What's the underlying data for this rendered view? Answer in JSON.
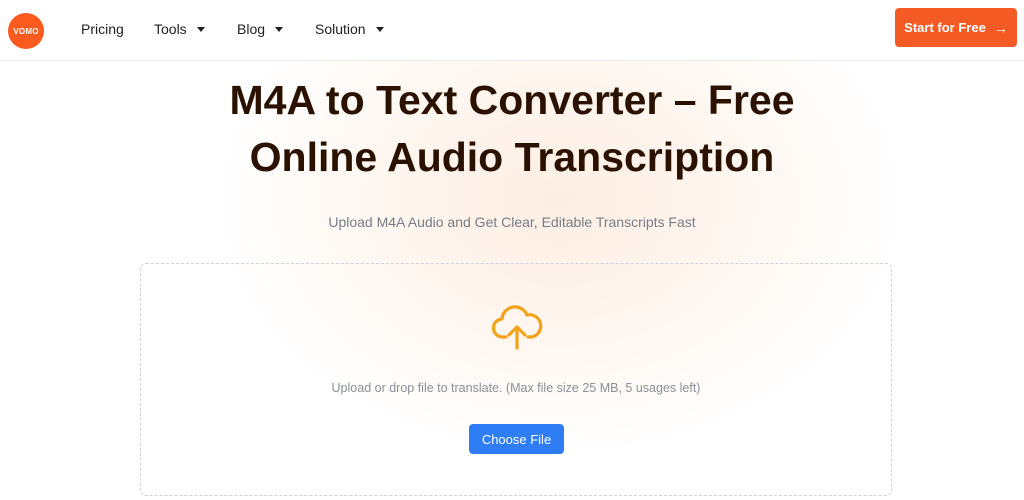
{
  "header": {
    "logo_text": "VOMO",
    "nav": [
      {
        "label": "Pricing"
      },
      {
        "label": "Tools"
      },
      {
        "label": "Blog"
      },
      {
        "label": "Solution"
      }
    ],
    "cta_label": "Start for Free",
    "cta_icon": "arrow-right-icon"
  },
  "hero": {
    "title_line1": "M4A to Text Converter – Free",
    "title_line2": "Online Audio Transcription",
    "subtitle": "Upload M4A Audio and Get Clear, Editable Transcripts Fast"
  },
  "upload": {
    "icon": "cloud-upload-icon",
    "hint": "Upload or drop file to translate. (Max file size 25 MB, 5 usages left)",
    "button_label": "Choose File"
  },
  "colors": {
    "brand": "#f45b24",
    "primary_button": "#2f7df5",
    "upload_icon": "#f5a21b",
    "title": "#2b1100"
  }
}
